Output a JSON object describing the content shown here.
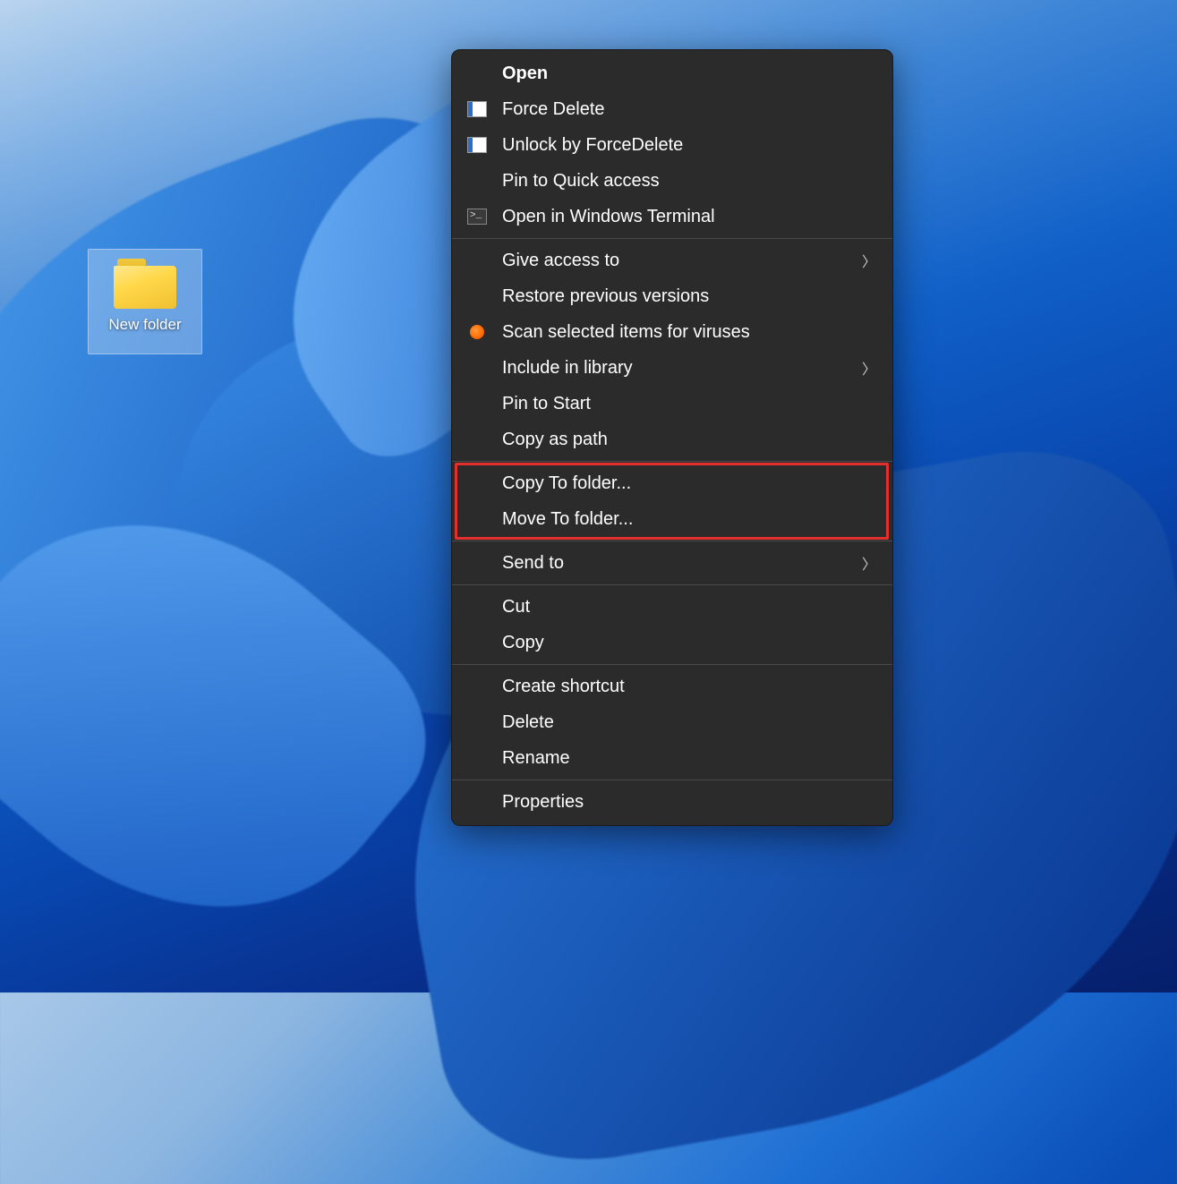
{
  "desktop": {
    "folder_label": "New folder"
  },
  "context_menu": {
    "groups": [
      [
        {
          "id": "open",
          "label": "Open",
          "bold": true,
          "icon": null,
          "submenu": false
        },
        {
          "id": "force-delete",
          "label": "Force Delete",
          "bold": false,
          "icon": "app",
          "submenu": false
        },
        {
          "id": "unlock-forcedelete",
          "label": "Unlock by ForceDelete",
          "bold": false,
          "icon": "app",
          "submenu": false
        },
        {
          "id": "pin-quick-access",
          "label": "Pin to Quick access",
          "bold": false,
          "icon": null,
          "submenu": false
        },
        {
          "id": "open-terminal",
          "label": "Open in Windows Terminal",
          "bold": false,
          "icon": "terminal",
          "submenu": false
        }
      ],
      [
        {
          "id": "give-access",
          "label": "Give access to",
          "bold": false,
          "icon": null,
          "submenu": true
        },
        {
          "id": "restore-versions",
          "label": "Restore previous versions",
          "bold": false,
          "icon": null,
          "submenu": false
        },
        {
          "id": "scan-viruses",
          "label": "Scan selected items for viruses",
          "bold": false,
          "icon": "avast",
          "submenu": false
        },
        {
          "id": "include-library",
          "label": "Include in library",
          "bold": false,
          "icon": null,
          "submenu": true
        },
        {
          "id": "pin-start",
          "label": "Pin to Start",
          "bold": false,
          "icon": null,
          "submenu": false
        },
        {
          "id": "copy-path",
          "label": "Copy as path",
          "bold": false,
          "icon": null,
          "submenu": false
        }
      ],
      [
        {
          "id": "copy-to-folder",
          "label": "Copy To folder...",
          "bold": false,
          "icon": null,
          "submenu": false,
          "highlighted": true
        },
        {
          "id": "move-to-folder",
          "label": "Move To folder...",
          "bold": false,
          "icon": null,
          "submenu": false,
          "highlighted": true
        }
      ],
      [
        {
          "id": "send-to",
          "label": "Send to",
          "bold": false,
          "icon": null,
          "submenu": true
        }
      ],
      [
        {
          "id": "cut",
          "label": "Cut",
          "bold": false,
          "icon": null,
          "submenu": false
        },
        {
          "id": "copy",
          "label": "Copy",
          "bold": false,
          "icon": null,
          "submenu": false
        }
      ],
      [
        {
          "id": "create-shortcut",
          "label": "Create shortcut",
          "bold": false,
          "icon": null,
          "submenu": false
        },
        {
          "id": "delete",
          "label": "Delete",
          "bold": false,
          "icon": null,
          "submenu": false
        },
        {
          "id": "rename",
          "label": "Rename",
          "bold": false,
          "icon": null,
          "submenu": false
        }
      ],
      [
        {
          "id": "properties",
          "label": "Properties",
          "bold": false,
          "icon": null,
          "submenu": false
        }
      ]
    ],
    "highlight_color": "#e3302f"
  }
}
